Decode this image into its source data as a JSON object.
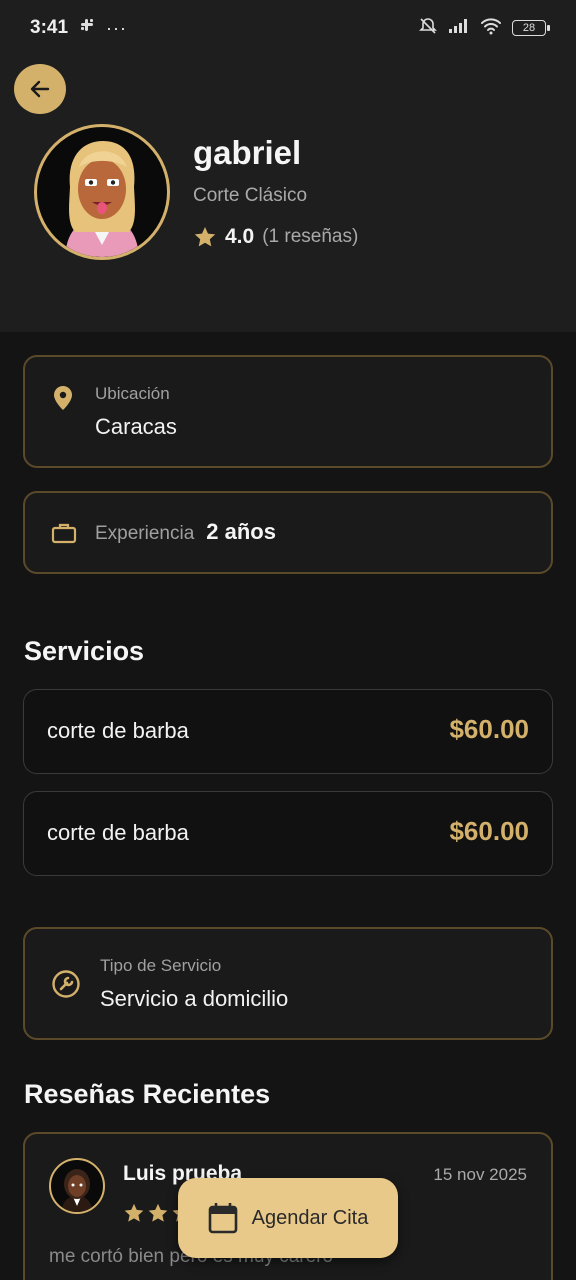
{
  "status_bar": {
    "time": "3:41",
    "battery": "28"
  },
  "profile": {
    "name": "gabriel",
    "specialty": "Corte Clásico",
    "rating": "4.0",
    "reviews_count": "(1 reseñas)"
  },
  "location": {
    "label": "Ubicación",
    "value": "Caracas"
  },
  "experience": {
    "label": "Experiencia",
    "value": "2 años"
  },
  "services": {
    "title": "Servicios",
    "items": [
      {
        "name": "corte de barba",
        "price": "$60.00"
      },
      {
        "name": "corte de barba",
        "price": "$60.00"
      }
    ]
  },
  "service_type": {
    "label": "Tipo de Servicio",
    "value": "Servicio a domicilio"
  },
  "reviews": {
    "title": "Reseñas Recientes",
    "items": [
      {
        "author": "Luis prueba",
        "date": "15 nov 2025",
        "stars": 3,
        "text": "me cortó bien pero es muy carero"
      }
    ]
  },
  "fab": {
    "label": "Agendar Cita"
  },
  "colors": {
    "accent": "#d4b16b",
    "background": "#141414",
    "header": "#1e1e1e"
  }
}
